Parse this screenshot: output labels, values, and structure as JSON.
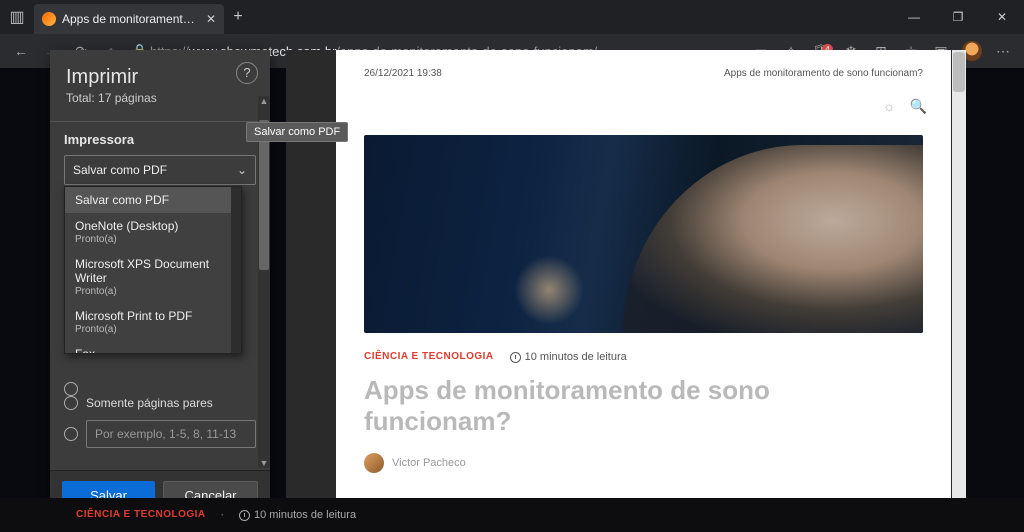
{
  "browser": {
    "tab_title": "Apps de monitoramento de sono",
    "url_prefix": "https://",
    "url_host": "www.showmetech.com.br",
    "url_path": "/apps-de-monitoramento-de-sono-funcionam/",
    "ext_badge": "4"
  },
  "print": {
    "title": "Imprimir",
    "subtitle": "Total: 17 páginas",
    "section_printer": "Impressora",
    "selected": "Salvar como PDF",
    "tooltip": "Salvar como PDF",
    "options": [
      {
        "label": "Salvar como PDF"
      },
      {
        "label": "OneNote (Desktop)",
        "sub": "Pronto(a)"
      },
      {
        "label": "Microsoft XPS Document Writer",
        "sub": "Pronto(a)"
      },
      {
        "label": "Microsoft Print to PDF",
        "sub": "Pronto(a)"
      },
      {
        "label": "Fax"
      }
    ],
    "even_label": "Somente páginas pares",
    "range_placeholder": "Por exemplo, 1-5, 8, 11-13",
    "save": "Salvar",
    "cancel": "Cancelar"
  },
  "article": {
    "datetime": "26/12/2021 19:38",
    "header_title": "Apps de monitoramento de sono funcionam?",
    "category": "CIÊNCIA E TECNOLOGIA",
    "read_time": "10 minutos de leitura",
    "title": "Apps de monitoramento de sono funcionam?",
    "author": "Victor Pacheco"
  }
}
